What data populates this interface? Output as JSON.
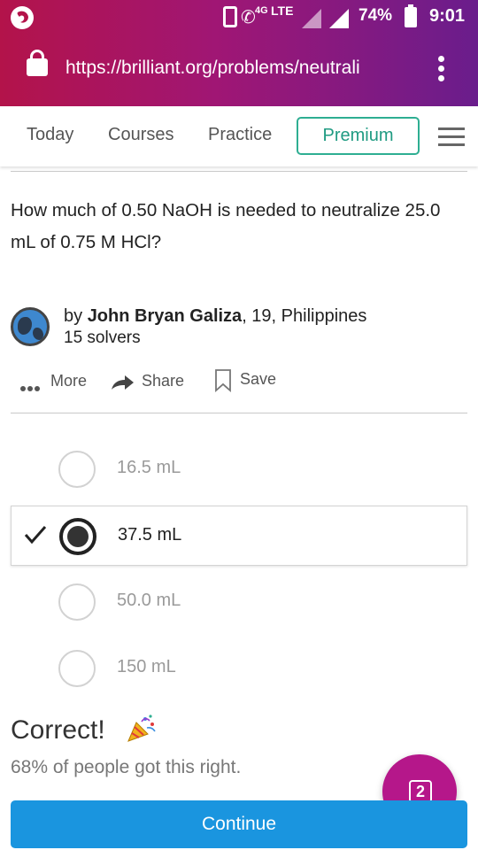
{
  "status_bar": {
    "network_4g": "4G",
    "network_lte": "LTE",
    "battery_percent": "74%",
    "time": "9:01"
  },
  "browser": {
    "url": "https://brilliant.org/problems/neutrali"
  },
  "nav": {
    "items": [
      {
        "label": "Today"
      },
      {
        "label": "Courses"
      },
      {
        "label": "Practice"
      }
    ],
    "premium_label": "Premium"
  },
  "problem": {
    "question": "How much of 0.50 NaOH is needed to neutralize 25.0 mL of 0.75 M HCl?",
    "author_prefix": "by",
    "author_name": "John Bryan Galiza",
    "author_details": ", 19, Philippines",
    "solvers": "15 solvers"
  },
  "actions": {
    "more_label": "More",
    "share_label": "Share",
    "save_label": "Save"
  },
  "options": [
    {
      "label": "16.5 mL",
      "selected": false
    },
    {
      "label": "37.5 mL",
      "selected": true
    },
    {
      "label": "50.0 mL",
      "selected": false
    },
    {
      "label": "150 mL",
      "selected": false
    }
  ],
  "result": {
    "title": "Correct!",
    "stat": "68% of people got this right."
  },
  "fab": {
    "count": "2"
  },
  "continue_label": "Continue",
  "colors": {
    "browser_gradient_start": "#b3134a",
    "browser_gradient_end": "#6a1d8c",
    "premium_accent": "#2eae92",
    "continue_button": "#1a95df",
    "fab": "#b5178a"
  },
  "icons": {
    "app": "firefox-icon",
    "lock": "lock-icon",
    "overflow": "vertical-dots-icon",
    "menu": "hamburger-icon",
    "more": "horizontal-dots-icon",
    "share": "share-arrow-icon",
    "save": "bookmark-icon",
    "check": "checkmark-icon",
    "party": "party-popper-icon"
  }
}
